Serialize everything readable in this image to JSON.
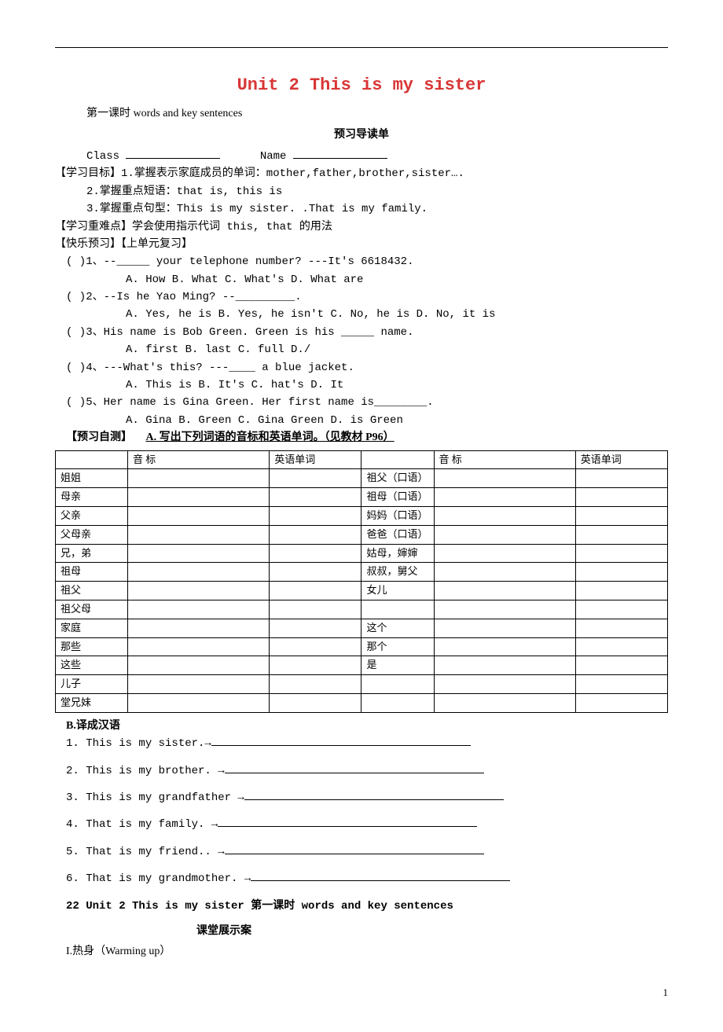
{
  "title": "Unit 2  This is my sister",
  "subtitle": "第一课时 words and key sentences",
  "preview_heading": "预习导读单",
  "class_label": "Class",
  "name_label": "Name",
  "goals_label": "【学习目标】",
  "goals": {
    "g1": "1.掌握表示家庭成员的单词：mother,father,brother,sister….",
    "g2": "2.掌握重点短语：that is, this is",
    "g3": "3.掌握重点句型：This is my sister. .That is my family."
  },
  "focus_label": "【学习重难点】",
  "focus_text": "学会使用指示代词 this, that 的用法",
  "happy_label": "【快乐预习】",
  "review_label": "【上单元复习】",
  "questions": {
    "q1": {
      "stem": "(   )1、--_____ your telephone number?  ---It's 6618432.",
      "opts": "A. How       B. What      C. What's    D. What are"
    },
    "q2": {
      "stem": "(   )2、--Is he Yao Ming?  --_________.",
      "opts": "A. Yes, he is    B. Yes, he isn't   C. No, he is   D. No, it is"
    },
    "q3": {
      "stem": "(   )3、His name is Bob Green. Green is his _____ name.",
      "opts": "A. first    B. last    C. full   D./"
    },
    "q4": {
      "stem": "(   )4、---What's this?  ---____ a blue jacket.",
      "opts": "A. This is    B. It's   C. hat's   D. It"
    },
    "q5": {
      "stem": "(   )5、Her name is Gina Green. Her first name is________.",
      "opts": "A. Gina    B. Green   C. Gina Green   D. is Green"
    }
  },
  "self_test_label": "【预习自测】",
  "self_test_a": "A. 写出下列词语的音标和英语单词。（见教材 P96）",
  "table_headers": {
    "phonetic": "音  标",
    "word": "英语单词"
  },
  "vocab_left": [
    "姐姐",
    "母亲",
    "父亲",
    "父母亲",
    "兄，弟",
    "祖母",
    "祖父",
    "祖父母",
    "家庭",
    "那些",
    "这些",
    "儿子",
    "堂兄妹"
  ],
  "vocab_right": [
    "祖父（口语）",
    "祖母（口语）",
    "妈妈（口语）",
    "爸爸（口语）",
    "姑母，婶婶",
    "叔叔，舅父",
    "女儿",
    "",
    "这个",
    "那个",
    "是",
    "",
    ""
  ],
  "section_b": "B.译成汉语",
  "translations": {
    "t1": "1. This is my sister.→",
    "t2": "2. This is my brother. →",
    "t3": "3. This is my grandfather →",
    "t4": "4. That is my family. →",
    "t5": "5. That is my friend.. →",
    "t6": "6. That is my grandmother. →"
  },
  "lesson_footer": "22    Unit 2  This is my sister 第一课时 words and key sentences",
  "class_show": "课堂展示案",
  "warming": "I.热身（Warming up）",
  "page_num": "1"
}
